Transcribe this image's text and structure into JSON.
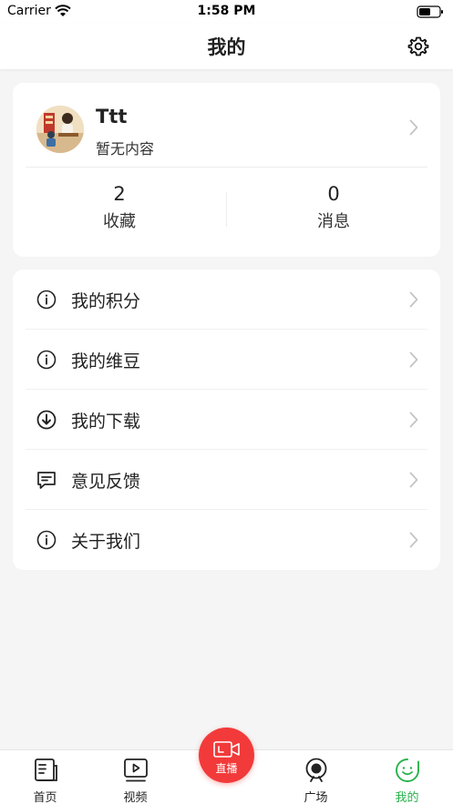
{
  "status_bar": {
    "carrier": "Carrier",
    "time": "1:58 PM"
  },
  "header": {
    "title": "我的"
  },
  "profile": {
    "username": "Ttt",
    "bio": "暂无内容",
    "stats": [
      {
        "value": "2",
        "label": "收藏"
      },
      {
        "value": "0",
        "label": "消息"
      }
    ]
  },
  "menu": {
    "items": [
      {
        "label": "我的积分",
        "icon": "info-icon"
      },
      {
        "label": "我的维豆",
        "icon": "info-icon"
      },
      {
        "label": "我的下载",
        "icon": "download-icon"
      },
      {
        "label": "意见反馈",
        "icon": "feedback-icon"
      },
      {
        "label": "关于我们",
        "icon": "info-icon"
      }
    ]
  },
  "tab_bar": {
    "tabs": [
      {
        "label": "首页",
        "icon": "home-icon"
      },
      {
        "label": "视频",
        "icon": "video-icon"
      },
      {
        "label": "直播",
        "icon": "live-camera-icon"
      },
      {
        "label": "广场",
        "icon": "square-icon"
      },
      {
        "label": "我的",
        "icon": "mine-icon",
        "active": true
      }
    ],
    "active_color": "#27b24b",
    "live_color": "#f23a3a"
  }
}
